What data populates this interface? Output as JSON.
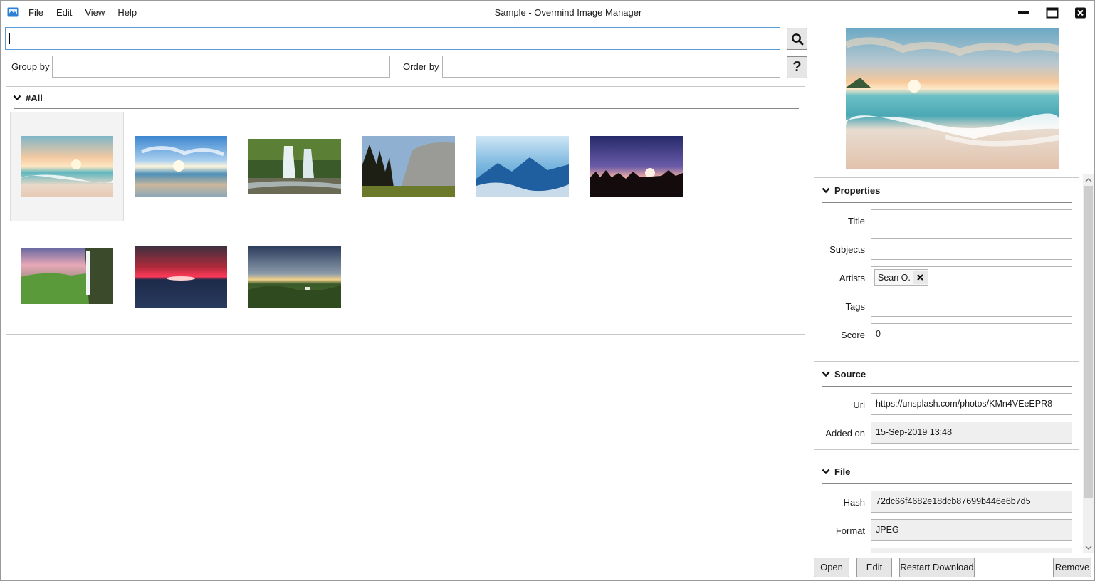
{
  "window": {
    "title": "Sample - Overmind Image Manager"
  },
  "menu": [
    "File",
    "Edit",
    "View",
    "Help"
  ],
  "search": {
    "value": "",
    "placeholder": ""
  },
  "toolbar": {
    "group_by_label": "Group by",
    "group_by_value": "",
    "order_by_label": "Order by",
    "order_by_value": "",
    "help_label": "?"
  },
  "gallery": {
    "group_name": "#All",
    "images": [
      {
        "subject": "beach sunset",
        "selected": true
      },
      {
        "subject": "ocean horizon with sun"
      },
      {
        "subject": "waterfall in forest"
      },
      {
        "subject": "granite cliff with pine trees"
      },
      {
        "subject": "mountains above clouds"
      },
      {
        "subject": "forest silhouette at dusk"
      },
      {
        "subject": "waterfall in green valley"
      },
      {
        "subject": "red sunset over mountains"
      },
      {
        "subject": "storm clouds over landscape"
      }
    ]
  },
  "properties": {
    "header": "Properties",
    "title_label": "Title",
    "title_value": "",
    "subjects_label": "Subjects",
    "subjects_value": "",
    "artists_label": "Artists",
    "artists": [
      "Sean O."
    ],
    "tags_label": "Tags",
    "tags_value": "",
    "score_label": "Score",
    "score_value": "0"
  },
  "source": {
    "header": "Source",
    "uri_label": "Uri",
    "uri_value": "https://unsplash.com/photos/KMn4VEeEPR8",
    "added_label": "Added on",
    "added_value": "15-Sep-2019 13:48"
  },
  "file": {
    "header": "File",
    "hash_label": "Hash",
    "hash_value": "72dc66f4682e18dcb87699b446e6b7d5",
    "format_label": "Format",
    "format_value": "JPEG"
  },
  "actions": {
    "open": "Open",
    "edit": "Edit",
    "restart_download": "Restart Download",
    "remove": "Remove"
  }
}
